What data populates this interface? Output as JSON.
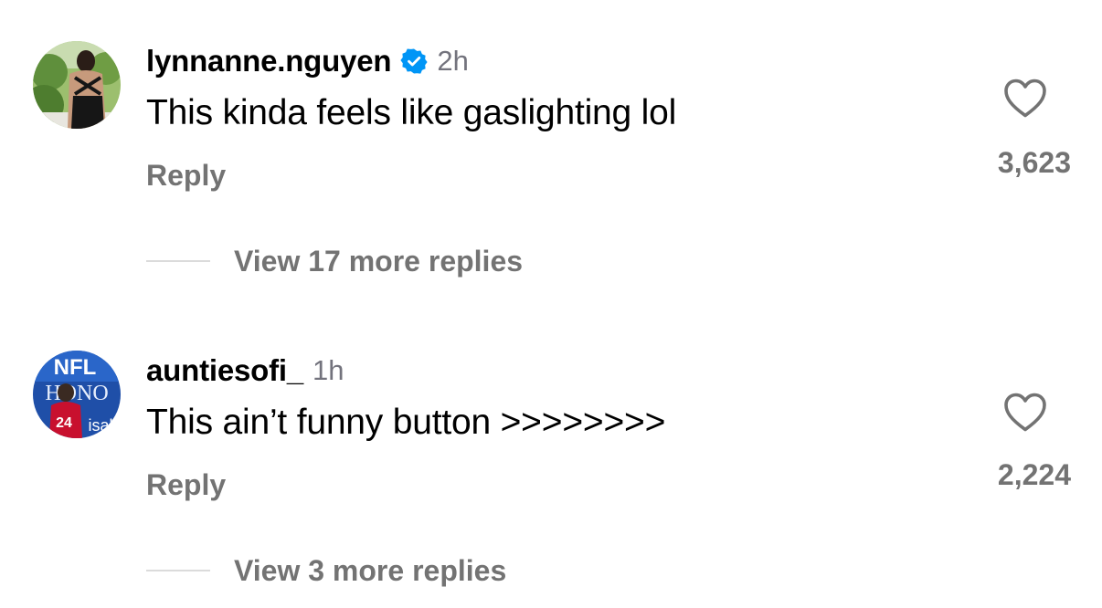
{
  "comments": [
    {
      "username": "lynnanne.nguyen",
      "verified": true,
      "timestamp": "2h",
      "text": "This kinda feels like gaslighting lol",
      "reply_label": "Reply",
      "like_count": "3,623",
      "like_icon": "heart-outline-icon",
      "view_replies_label": "View 17 more replies"
    },
    {
      "username": "auntiesofi_",
      "verified": false,
      "timestamp": "1h",
      "text": "This ain’t funny button >>>>>>>>",
      "reply_label": "Reply",
      "like_count": "2,224",
      "like_icon": "heart-outline-icon",
      "view_replies_label": "View 3 more replies",
      "avatar_text": {
        "banner": "NFL",
        "sign": "HONO",
        "jersey": "24",
        "bottom": "isal"
      }
    }
  ],
  "colors": {
    "verified_badge": "#0095f6",
    "secondary_text": "#737373",
    "thread_line": "#dbdbdb"
  }
}
